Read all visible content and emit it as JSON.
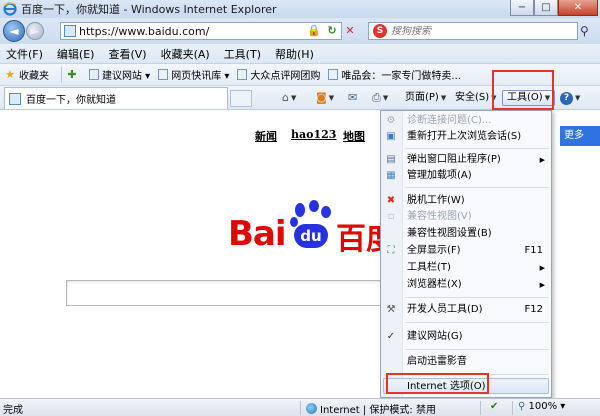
{
  "window": {
    "title": "百度一下，你就知道 - Windows Internet Explorer",
    "min_label": "−",
    "max_label": "□",
    "close_label": "✕"
  },
  "address": {
    "url": "https://www.baidu.com/",
    "search_placeholder": "搜狗搜索",
    "back_glyph": "◄",
    "forward_glyph": "►"
  },
  "menubar": {
    "items": [
      "文件(F)",
      "编辑(E)",
      "查看(V)",
      "收藏夹(A)",
      "工具(T)",
      "帮助(H)"
    ]
  },
  "favorites": {
    "label": "收藏夹",
    "items": [
      "建议网站 ▾",
      "网页快讯库 ▾",
      "大众点评网团购",
      "唯品会：一家专门做特卖..."
    ]
  },
  "tab": {
    "label": "百度一下，你就知道"
  },
  "commandbar": {
    "page": "页面(P)",
    "safety": "安全(S)",
    "tools": "工具(O)"
  },
  "content": {
    "nav": [
      "新闻",
      "hao123",
      "地图"
    ],
    "more": "更多",
    "logo_left": "Bai",
    "logo_du": "du",
    "logo_right": "百度"
  },
  "tools_menu": {
    "items": [
      {
        "label": "诊断连接问题(C)...",
        "disabled": true
      },
      {
        "label": "重新打开上次浏览会话(S)"
      },
      {
        "label": "弹出窗口阻止程序(P)",
        "submenu": true
      },
      {
        "label": "管理加载项(A)"
      },
      {
        "label": "脱机工作(W)"
      },
      {
        "label": "兼容性视图(V)",
        "disabled": true
      },
      {
        "label": "兼容性视图设置(B)"
      },
      {
        "label": "全屏显示(F)",
        "shortcut": "F11"
      },
      {
        "label": "工具栏(T)",
        "submenu": true
      },
      {
        "label": "浏览器栏(X)",
        "submenu": true
      },
      {
        "label": "开发人员工具(D)",
        "shortcut": "F12"
      },
      {
        "label": "建议网站(G)",
        "checked": true
      },
      {
        "label": "启动迅雷影音"
      },
      {
        "label": "Internet 选项(O)"
      }
    ]
  },
  "status": {
    "left": "完成",
    "zone": "Internet | 保护模式: 禁用",
    "zoom": "100%"
  },
  "colors": {
    "highlight_box": "#e8332a",
    "baidu_red": "#e10602",
    "baidu_blue": "#2932e1"
  }
}
